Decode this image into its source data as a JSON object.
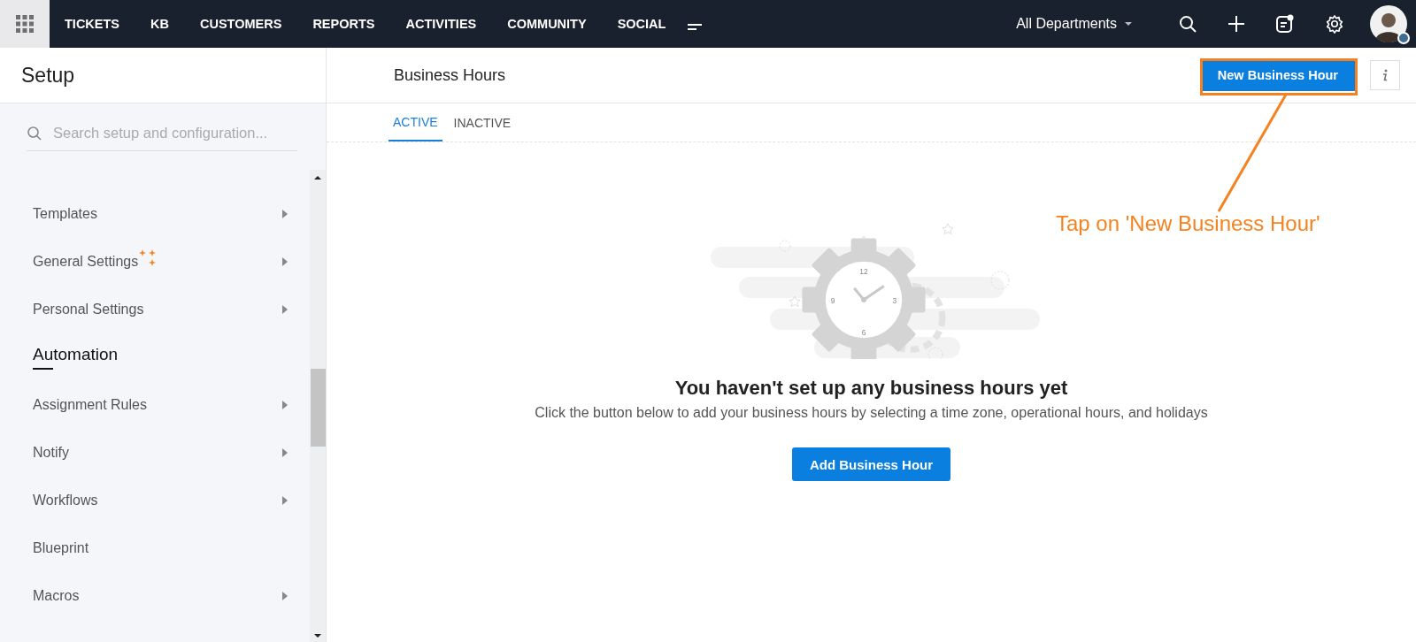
{
  "topbar": {
    "nav": [
      {
        "label": "TICKETS"
      },
      {
        "label": "KB"
      },
      {
        "label": "CUSTOMERS"
      },
      {
        "label": "REPORTS"
      },
      {
        "label": "ACTIVITIES"
      },
      {
        "label": "COMMUNITY"
      },
      {
        "label": "SOCIAL"
      }
    ],
    "department": "All Departments"
  },
  "sidebar": {
    "title": "Setup",
    "search": {
      "placeholder": "Search setup and configuration..."
    },
    "items": [
      {
        "kind": "item",
        "label": "Templates",
        "submenu": true,
        "new": false
      },
      {
        "kind": "item",
        "label": "General Settings",
        "submenu": true,
        "new": true
      },
      {
        "kind": "item",
        "label": "Personal Settings",
        "submenu": true,
        "new": false
      },
      {
        "kind": "section",
        "label": "Automation"
      },
      {
        "kind": "item",
        "label": "Assignment Rules",
        "submenu": true,
        "new": false
      },
      {
        "kind": "item",
        "label": "Notify",
        "submenu": true,
        "new": false
      },
      {
        "kind": "item",
        "label": "Workflows",
        "submenu": true,
        "new": false
      },
      {
        "kind": "item",
        "label": "Blueprint",
        "submenu": false,
        "new": false
      },
      {
        "kind": "item",
        "label": "Macros",
        "submenu": true,
        "new": false
      }
    ]
  },
  "main": {
    "title": "Business Hours",
    "new_button": "New Business Hour",
    "tabs": [
      {
        "label": "ACTIVE",
        "selected": true
      },
      {
        "label": "INACTIVE",
        "selected": false
      }
    ],
    "empty_state": {
      "clock_numbers": [
        "12",
        "3",
        "6",
        "9"
      ],
      "heading": "You haven't set up any business hours yet",
      "message": "Click the button below to add your business hours by selecting a time zone, operational hours, and holidays",
      "button": "Add Business Hour"
    }
  },
  "annotation": {
    "text": "Tap on 'New Business Hour'"
  }
}
